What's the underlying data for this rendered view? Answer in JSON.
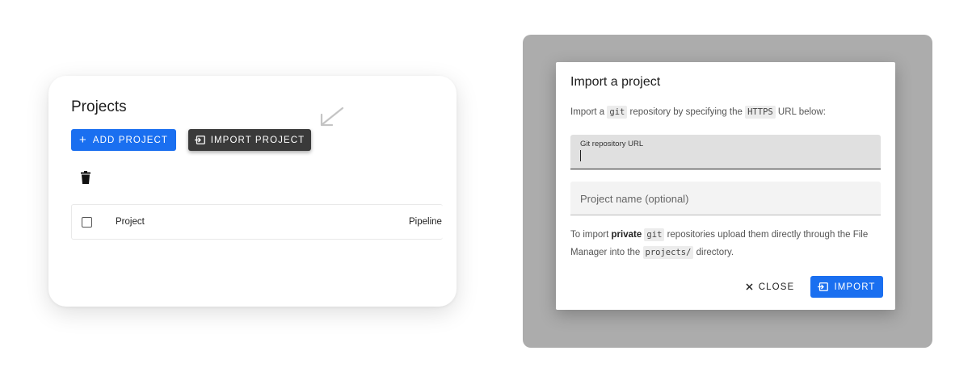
{
  "projects_card": {
    "title": "Projects",
    "add_project_label": "ADD PROJECT",
    "import_project_label": "IMPORT PROJECT",
    "table": {
      "columns": [
        "Project",
        "Pipeline"
      ]
    }
  },
  "import_dialog": {
    "title": "Import a project",
    "intro": {
      "part1": "Import a ",
      "code1": "git",
      "part2": " repository by specifying the ",
      "code2": "HTTPS",
      "part3": " URL below:"
    },
    "url_field": {
      "label": "Git repository URL",
      "value": ""
    },
    "name_field": {
      "placeholder": "Project name (optional)",
      "value": ""
    },
    "note": {
      "part1": "To import ",
      "bold": "private",
      "part2": " ",
      "code1": "git",
      "part3": " repositories upload them directly through the File Manager into the ",
      "code2": "projects/",
      "part4": " directory."
    },
    "close_label": "CLOSE",
    "import_label": "IMPORT"
  },
  "colors": {
    "primary": "#1a6ff0",
    "dark_button": "#3a3a3a",
    "backdrop": "#acacac"
  },
  "icons": [
    "plus-icon",
    "import-icon",
    "trash-icon",
    "checkbox-icon",
    "arrow-icon",
    "close-icon"
  ]
}
